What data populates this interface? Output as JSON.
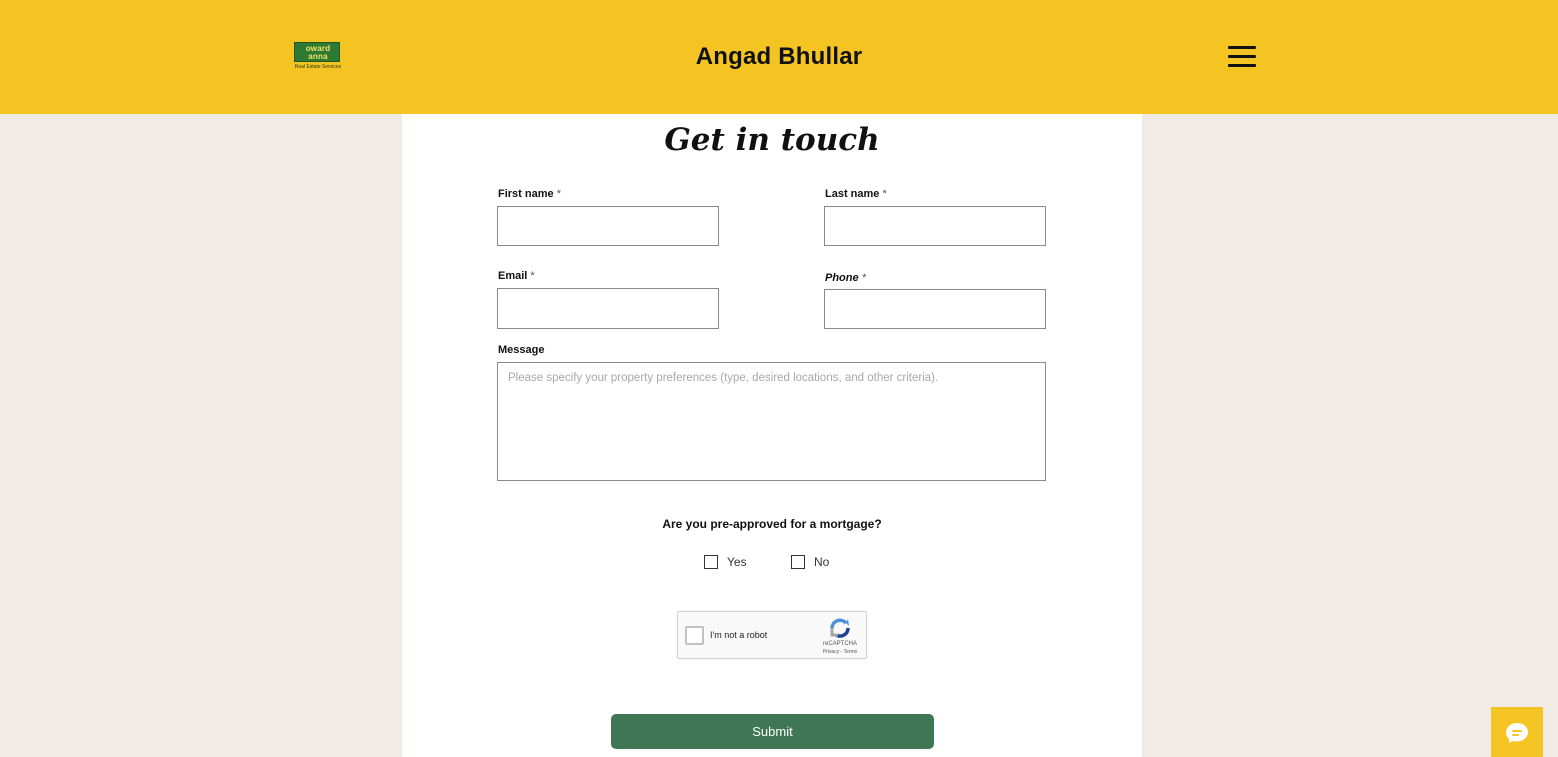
{
  "header": {
    "logo_line1": "oward",
    "logo_line2": "anna",
    "logo_sub": "Real Estate Services",
    "title": "Angad Bhullar",
    "menu_icon": "hamburger-menu-icon",
    "background_color": "#f4c522"
  },
  "form": {
    "heading": "Get in touch",
    "first_name": {
      "label": "First name",
      "required": "*",
      "value": ""
    },
    "last_name": {
      "label": "Last name",
      "required": "*",
      "value": ""
    },
    "email": {
      "label": "Email",
      "required": "*",
      "value": ""
    },
    "phone": {
      "label": "Phone",
      "required": "*",
      "value": ""
    },
    "message": {
      "label": "Message",
      "placeholder": "Please specify your property preferences (type, desired locations, and other criteria).",
      "value": ""
    },
    "mortgage_question": "Are you pre-approved for a mortgage?",
    "options": [
      {
        "label": "Yes",
        "checked": false
      },
      {
        "label": "No",
        "checked": false
      }
    ],
    "captcha": {
      "label": "I'm not a robot",
      "brand": "reCAPTCHA",
      "links": "Privacy - Terms"
    },
    "submit_label": "Submit",
    "submit_color": "#3f7754"
  },
  "chat_button": {
    "icon": "chat-bubble-icon",
    "color": "#f4c522"
  }
}
